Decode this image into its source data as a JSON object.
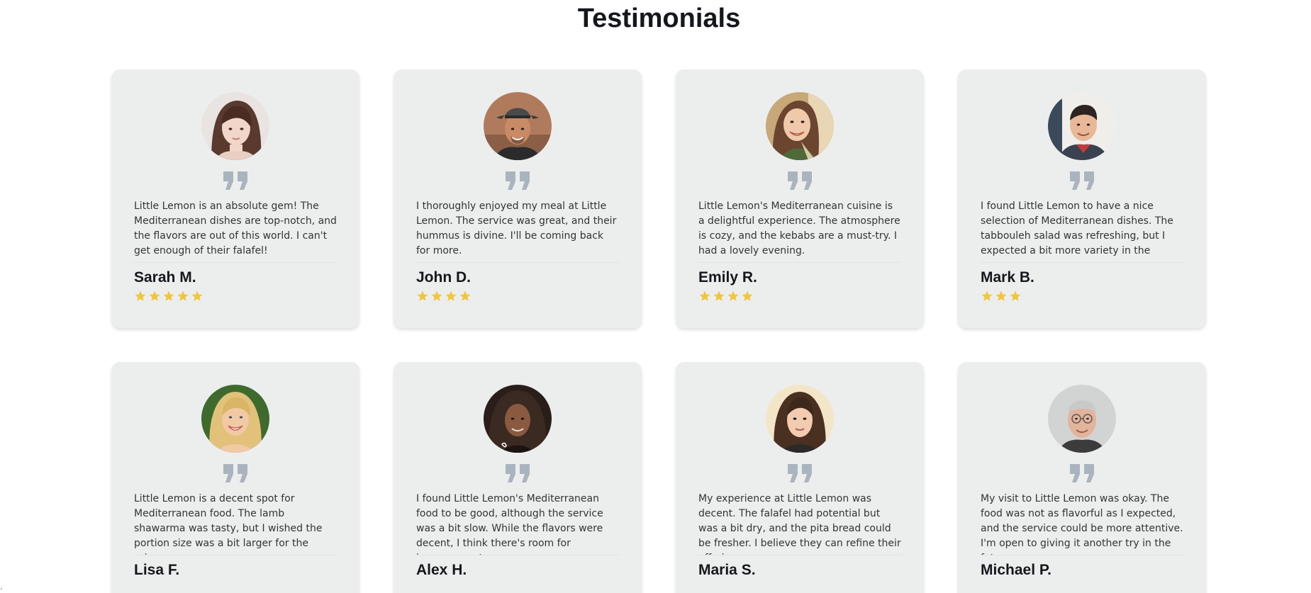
{
  "section": {
    "title": "Testimonials"
  },
  "colors": {
    "card_background": "#eceeed",
    "star": "#f1c738",
    "quote_icon": "#aab4be",
    "title": "#15171c"
  },
  "testimonials": [
    {
      "name": "Sarah M.",
      "text": "Little Lemon is an absolute gem! The Mediterranean dishes are top-notch, and the flavors are out of this world. I can't get enough of their falafel!",
      "rating": 5,
      "avatar_icon": "avatar-photo-icon"
    },
    {
      "name": "John D.",
      "text": "I thoroughly enjoyed my meal at Little Lemon. The service was great, and their hummus is divine. I'll be coming back for more.",
      "rating": 4,
      "avatar_icon": "avatar-photo-icon"
    },
    {
      "name": "Emily R.",
      "text": "Little Lemon's Mediterranean cuisine is a delightful experience. The atmosphere is cozy, and the kebabs are a must-try. I had a lovely evening.",
      "rating": 4,
      "avatar_icon": "avatar-photo-icon"
    },
    {
      "name": "Mark B.",
      "text": "I found Little Lemon to have a nice selection of Mediterranean dishes. The tabbouleh salad was refreshing, but I expected a bit more variety in the menu.",
      "rating": 3,
      "avatar_icon": "avatar-photo-icon"
    },
    {
      "name": "Lisa F.",
      "text": "Little Lemon is a decent spot for Mediterranean food. The lamb shawarma was tasty, but I wished the portion size was a bit larger for the price.",
      "rating": null,
      "avatar_icon": "avatar-photo-icon"
    },
    {
      "name": "Alex H.",
      "text": "I found Little Lemon's Mediterranean food to be good, although the service was a bit slow. While the flavors were decent, I think there's room for improvement.",
      "rating": null,
      "avatar_icon": "avatar-photo-icon"
    },
    {
      "name": "Maria S.",
      "text": "My experience at Little Lemon was decent. The falafel had potential but was a bit dry, and the pita bread could be fresher. I believe they can refine their offerings.",
      "rating": null,
      "avatar_icon": "avatar-photo-icon"
    },
    {
      "name": "Michael P.",
      "text": "My visit to Little Lemon was okay. The food was not as flavorful as I expected, and the service could be more attentive. I'm open to giving it another try in the future.",
      "rating": null,
      "avatar_icon": "avatar-photo-icon"
    }
  ],
  "scrollbar": {
    "left_arrow_icon": "chevron-left-icon",
    "left_arrow_glyph": "‹"
  }
}
